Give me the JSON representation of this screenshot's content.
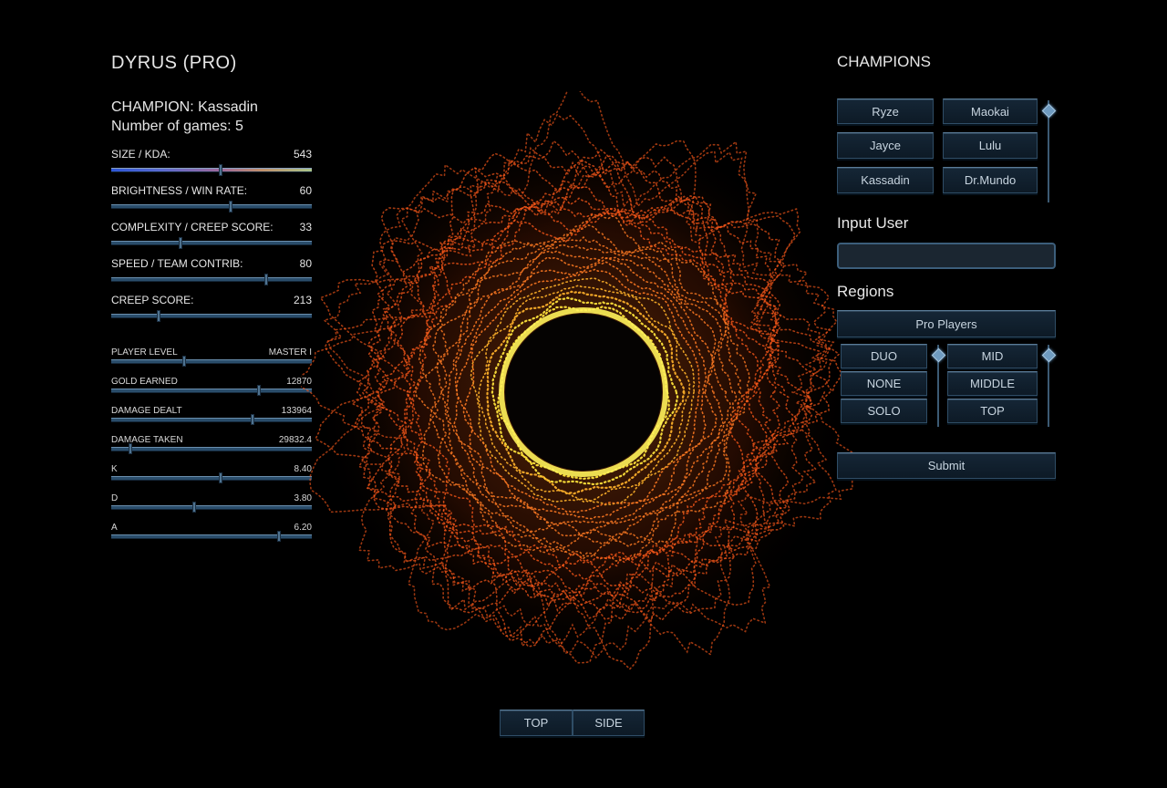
{
  "player": {
    "title": "DYRUS (PRO)",
    "champion_line": "CHAMPION: Kassadin",
    "games_line": "Number of games: 5"
  },
  "parameters": [
    {
      "label": "SIZE / KDA:",
      "value": "543",
      "fraction": 0.54
    },
    {
      "label": "BRIGHTNESS / WIN RATE:",
      "value": "60",
      "fraction": 0.59
    },
    {
      "label": "COMPLEXITY / CREEP SCORE:",
      "value": "33",
      "fraction": 0.34
    },
    {
      "label": "SPEED / TEAM CONTRIB:",
      "value": "80",
      "fraction": 0.77
    },
    {
      "label": "CREEP SCORE:",
      "value": "213",
      "fraction": 0.23
    }
  ],
  "stats": [
    {
      "label": "PLAYER LEVEL",
      "value": "MASTER I",
      "fraction": 0.36
    },
    {
      "label": "GOLD EARNED",
      "value": "12870",
      "fraction": 0.73
    },
    {
      "label": "DAMAGE DEALT",
      "value": "133964",
      "fraction": 0.7
    },
    {
      "label": "DAMAGE TAKEN",
      "value": "29832.4",
      "fraction": 0.09
    },
    {
      "label": "K",
      "value": "8.40",
      "fraction": 0.54
    },
    {
      "label": "D",
      "value": "3.80",
      "fraction": 0.41
    },
    {
      "label": "A",
      "value": "6.20",
      "fraction": 0.83
    }
  ],
  "champions": {
    "title": "CHAMPIONS",
    "items": [
      "Ryze",
      "Maokai",
      "Jayce",
      "Lulu",
      "Kassadin",
      "Dr.Mundo"
    ]
  },
  "input_user": {
    "title": "Input User",
    "value": "",
    "placeholder": ""
  },
  "regions": {
    "title": "Regions",
    "pro_players": "Pro Players",
    "queue_options": [
      "DUO",
      "NONE",
      "SOLO"
    ],
    "lane_options": [
      "MID",
      "MIDDLE",
      "TOP"
    ],
    "submit": "Submit"
  },
  "view_buttons": [
    "TOP",
    "SIDE"
  ],
  "colors": {
    "background": "#000000",
    "button_bg": "#152636",
    "button_border": "#2f4d66",
    "accent": "#6f9bc0",
    "viz_core": "#ffe94a",
    "viz_outer": "#ff5a1a"
  }
}
